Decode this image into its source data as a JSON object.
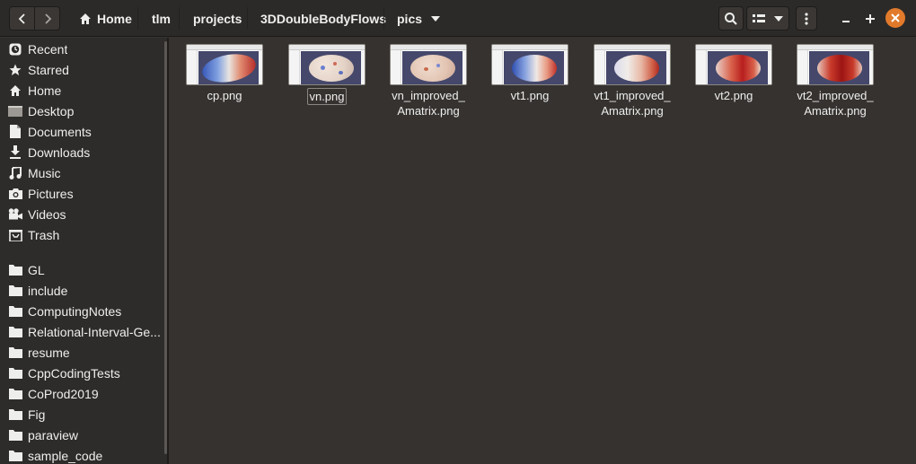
{
  "header": {
    "back_icon": "go-previous-icon",
    "forward_icon": "go-next-icon",
    "breadcrumbs": [
      {
        "label": "Home",
        "icon": "home-icon"
      },
      {
        "label": "tlm"
      },
      {
        "label": "projects"
      },
      {
        "label": "3DDoubleBodyFlows"
      },
      {
        "label": "pics",
        "icon": "chevron-down-icon"
      }
    ],
    "search_icon": "search-icon",
    "view_icon": "list-view-icon",
    "view_dropdown_icon": "chevron-down-icon",
    "menu_icon": "kebab-menu-icon",
    "minimize_icon": "minimize-icon",
    "maximize_icon": "maximize-icon",
    "close_icon": "close-icon",
    "close_color": "#e27a2b"
  },
  "sidebar": {
    "places": [
      {
        "label": "Recent",
        "icon": "clock-icon"
      },
      {
        "label": "Starred",
        "icon": "star-icon"
      },
      {
        "label": "Home",
        "icon": "home-icon"
      },
      {
        "label": "Desktop",
        "icon": "desktop-icon"
      },
      {
        "label": "Documents",
        "icon": "document-icon"
      },
      {
        "label": "Downloads",
        "icon": "download-icon"
      },
      {
        "label": "Music",
        "icon": "music-icon"
      },
      {
        "label": "Pictures",
        "icon": "camera-icon"
      },
      {
        "label": "Videos",
        "icon": "video-icon"
      },
      {
        "label": "Trash",
        "icon": "trash-icon"
      }
    ],
    "bookmarks": [
      {
        "label": "GL",
        "icon": "folder-icon"
      },
      {
        "label": "include",
        "icon": "folder-icon"
      },
      {
        "label": "ComputingNotes",
        "icon": "folder-icon"
      },
      {
        "label": "Relational-Interval-Ge...",
        "icon": "folder-icon"
      },
      {
        "label": "resume",
        "icon": "folder-icon"
      },
      {
        "label": "CppCodingTests",
        "icon": "folder-icon"
      },
      {
        "label": "CoProd2019",
        "icon": "folder-icon"
      },
      {
        "label": "Fig",
        "icon": "folder-icon"
      },
      {
        "label": "paraview",
        "icon": "folder-icon"
      },
      {
        "label": "sample_code",
        "icon": "folder-icon"
      }
    ]
  },
  "files": [
    {
      "name": "cp.png",
      "palette": "blue-red"
    },
    {
      "name": "vn.png",
      "palette": "speckled",
      "focused": true
    },
    {
      "name": "vn_improved_ Amatrix.png",
      "palette": "speckled-warm"
    },
    {
      "name": "vt1.png",
      "palette": "blue-white-red"
    },
    {
      "name": "vt1_improved_ Amatrix.png",
      "palette": "white-red"
    },
    {
      "name": "vt2.png",
      "palette": "red"
    },
    {
      "name": "vt2_improved_ Amatrix.png",
      "palette": "red-dark"
    }
  ],
  "colors": {
    "background": "#353230",
    "headerbar": "#2c2a28",
    "sidebar": "#2e2c2a",
    "text": "#eeeeec"
  }
}
